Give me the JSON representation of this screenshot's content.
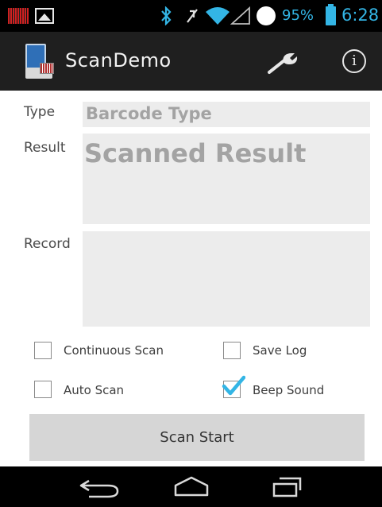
{
  "status_bar": {
    "battery_percent": "95%",
    "time": "6:28",
    "accent_color": "#33b5e5",
    "icons": [
      "barcode-notification-icon",
      "gallery-notification-icon",
      "bluetooth-icon",
      "mute-icon",
      "wifi-icon",
      "cell-signal-icon",
      "alarm-icon",
      "battery-icon"
    ]
  },
  "action_bar": {
    "title": "ScanDemo",
    "icons": [
      "app-icon",
      "wrench-icon",
      "info-icon"
    ],
    "info_glyph": "i"
  },
  "form": {
    "type_label": "Type",
    "type_value": "Barcode Type",
    "result_label": "Result",
    "result_value": "Scanned Result",
    "record_label": "Record",
    "record_value": ""
  },
  "options": {
    "continuous_scan": {
      "label": "Continuous Scan",
      "checked": false
    },
    "save_log": {
      "label": "Save Log",
      "checked": false
    },
    "auto_scan": {
      "label": "Auto Scan",
      "checked": false
    },
    "beep_sound": {
      "label": "Beep Sound",
      "checked": true
    }
  },
  "scan_button": {
    "label": "Scan Start"
  },
  "nav_bar": {
    "icons": [
      "back-icon",
      "home-icon",
      "recent-apps-icon"
    ]
  }
}
